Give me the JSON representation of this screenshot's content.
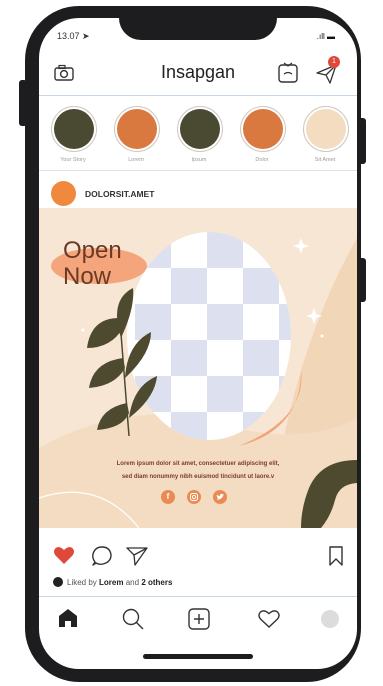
{
  "status": {
    "time": "13.07",
    "signal": ".ıll",
    "battery": "▬"
  },
  "header": {
    "title": "Insapgan",
    "notification_count": "1"
  },
  "stories": [
    {
      "label": "Your Story",
      "color": "#4a4a32"
    },
    {
      "label": "Lorem",
      "color": "#d9783f"
    },
    {
      "label": "Ipsum",
      "color": "#4a4a32"
    },
    {
      "label": "Dolor",
      "color": "#d9783f"
    },
    {
      "label": "Sit Amet",
      "color": "#f4dcc0"
    }
  ],
  "post": {
    "username": "DOLORSIT.AMET",
    "headline_line1": "Open",
    "headline_line2": "Now",
    "description_line1": "Lorem ipsum dolor sit amet, consectetuer adipiscing elit,",
    "description_line2": "sed diam nonummy nibh euismod tincidunt ut laore.v",
    "social_icons": [
      "facebook-icon",
      "instagram-icon",
      "twitter-icon"
    ],
    "likes_prefix": "Liked by",
    "likes_user": "Lorem",
    "likes_and": "and",
    "likes_others": "2 others"
  },
  "colors": {
    "accent": "#f0883d",
    "like": "#e0483a",
    "dark_olive": "#4a4a32"
  }
}
